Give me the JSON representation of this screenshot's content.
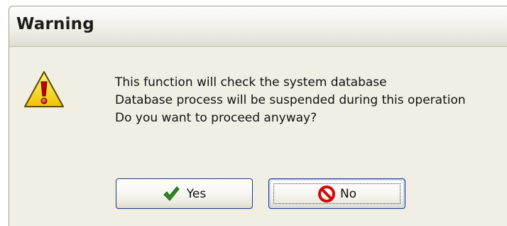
{
  "dialog": {
    "title": "Warning",
    "icon": "warning-triangle-icon",
    "message_lines": [
      "This function will check the system database",
      "Database process will be suspended during this operation",
      "Do you want to proceed anyway?"
    ]
  },
  "buttons": {
    "yes": {
      "label": "Yes",
      "icon": "checkmark-icon",
      "icon_color": "#2e8b1e"
    },
    "no": {
      "label": "No",
      "icon": "prohibited-icon",
      "icon_color": "#d10a0a",
      "focused": true
    }
  },
  "colors": {
    "dialog_bg": "#f1efe3",
    "button_border": "#173a88",
    "warning_yellow": "#f7d417"
  }
}
